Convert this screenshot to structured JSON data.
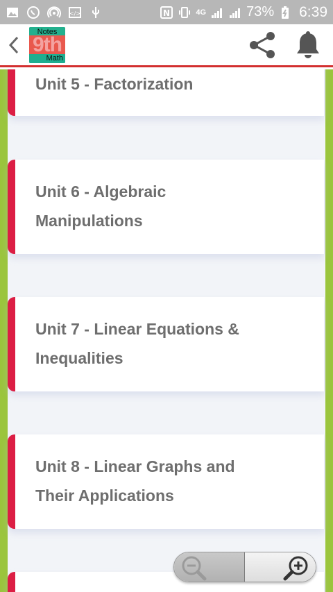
{
  "status_bar": {
    "left_icons": [
      "gallery-icon",
      "whatsapp-icon",
      "hotspot-icon",
      "code-icon",
      "usb-icon"
    ],
    "nfc": "N",
    "network_type": "4G",
    "battery": "73%",
    "time": "6:39"
  },
  "toolbar": {
    "logo": {
      "top": "Notes",
      "middle": "9th",
      "bottom": "Math"
    }
  },
  "units": [
    {
      "title_line1": "Unit 5 - Factorization",
      "title_line2": ""
    },
    {
      "title_line1": "Unit 6 - Algebraic",
      "title_line2": "Manipulations"
    },
    {
      "title_line1": "Unit 7 - Linear Equations &",
      "title_line2": "Inequalities"
    },
    {
      "title_line1": "Unit 8 - Linear Graphs and",
      "title_line2": "Their Applications"
    }
  ],
  "colors": {
    "accent_red": "#dc1e44",
    "side_green": "#9bc53d",
    "toolbar_border": "#d32f2f"
  }
}
